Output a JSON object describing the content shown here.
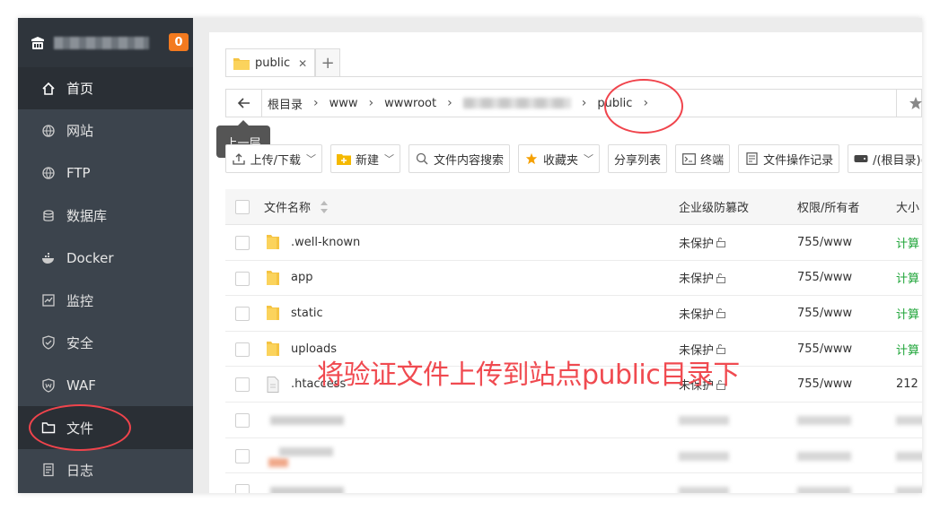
{
  "sidebar": {
    "badge": "0",
    "items": [
      {
        "label": "首页",
        "icon": "home-icon"
      },
      {
        "label": "网站",
        "icon": "globe-icon"
      },
      {
        "label": "FTP",
        "icon": "globe-icon"
      },
      {
        "label": "数据库",
        "icon": "database-icon"
      },
      {
        "label": "Docker",
        "icon": "docker-icon"
      },
      {
        "label": "监控",
        "icon": "monitor-icon"
      },
      {
        "label": "安全",
        "icon": "shield-icon"
      },
      {
        "label": "WAF",
        "icon": "waf-shield-icon"
      },
      {
        "label": "文件",
        "icon": "folder-icon"
      },
      {
        "label": "日志",
        "icon": "log-icon"
      }
    ]
  },
  "tabs": {
    "active": "public",
    "close": "✕",
    "add": "+"
  },
  "breadcrumb": {
    "items": [
      "根目录",
      "www",
      "wwwroot",
      "public"
    ],
    "tooltip": "上一层"
  },
  "toolbar": {
    "upload": "上传/下载",
    "new": "新建",
    "search": "文件内容搜索",
    "favorites": "收藏夹",
    "share": "分享列表",
    "terminal": "终端",
    "oplog": "文件操作记录",
    "disk": "/(根目录)("
  },
  "table": {
    "headers": {
      "name": "文件名称",
      "protect": "企业级防篡改",
      "perm": "权限/所有者",
      "size": "大小"
    },
    "rows": [
      {
        "name": ".well-known",
        "type": "folder",
        "protect": "未保护",
        "perm": "755/www",
        "size": "计算"
      },
      {
        "name": "app",
        "type": "folder",
        "protect": "未保护",
        "perm": "755/www",
        "size": "计算"
      },
      {
        "name": "static",
        "type": "folder",
        "protect": "未保护",
        "perm": "755/www",
        "size": "计算"
      },
      {
        "name": "uploads",
        "type": "folder",
        "protect": "未保护",
        "perm": "755/www",
        "size": "计算"
      },
      {
        "name": ".htaccess",
        "type": "file",
        "protect": "未保护",
        "perm": "755/www",
        "size": "212"
      }
    ]
  },
  "annotation": {
    "text": "将验证文件上传到站点public目录下",
    "color": "#f04a50"
  },
  "colors": {
    "sidebar": "#3c444d",
    "sidebar_active": "#2a2f35",
    "badge": "#f37a1f",
    "green": "#20a53a",
    "highlight": "#f0444c"
  }
}
